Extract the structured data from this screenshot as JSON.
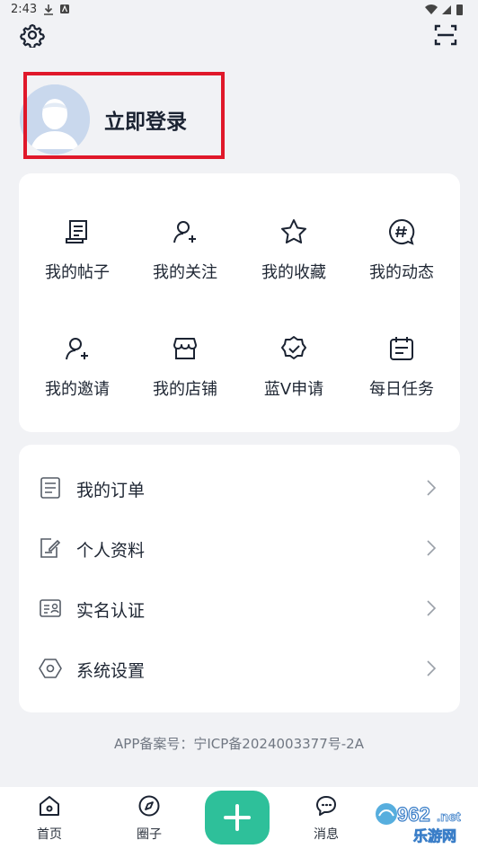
{
  "status_bar": {
    "time": "2:43"
  },
  "profile": {
    "login_label": "立即登录"
  },
  "quick_grid": [
    {
      "label": "我的帖子",
      "icon": "post-icon"
    },
    {
      "label": "我的关注",
      "icon": "user-add-icon"
    },
    {
      "label": "我的收藏",
      "icon": "star-icon"
    },
    {
      "label": "我的动态",
      "icon": "hashtag-icon"
    },
    {
      "label": "我的邀请",
      "icon": "user-add-icon"
    },
    {
      "label": "我的店铺",
      "icon": "store-icon"
    },
    {
      "label": "蓝V申请",
      "icon": "verified-badge-icon"
    },
    {
      "label": "每日任务",
      "icon": "calendar-icon"
    }
  ],
  "menu_list": [
    {
      "label": "我的订单",
      "icon": "order-icon"
    },
    {
      "label": "个人资料",
      "icon": "edit-document-icon"
    },
    {
      "label": "实名认证",
      "icon": "id-card-icon"
    },
    {
      "label": "系统设置",
      "icon": "hexagon-settings-icon"
    }
  ],
  "icp_text": "APP备案号：宁ICP备2024003377号-2A",
  "tabbar": {
    "home": "首页",
    "circle": "圈子",
    "messages": "消息"
  },
  "watermark": {
    "number": "962",
    "suffix": ".net",
    "text": "乐游网"
  },
  "colors": {
    "accent": "#2ec09a",
    "highlight": "#e0182a",
    "background": "#f1f2f5"
  }
}
